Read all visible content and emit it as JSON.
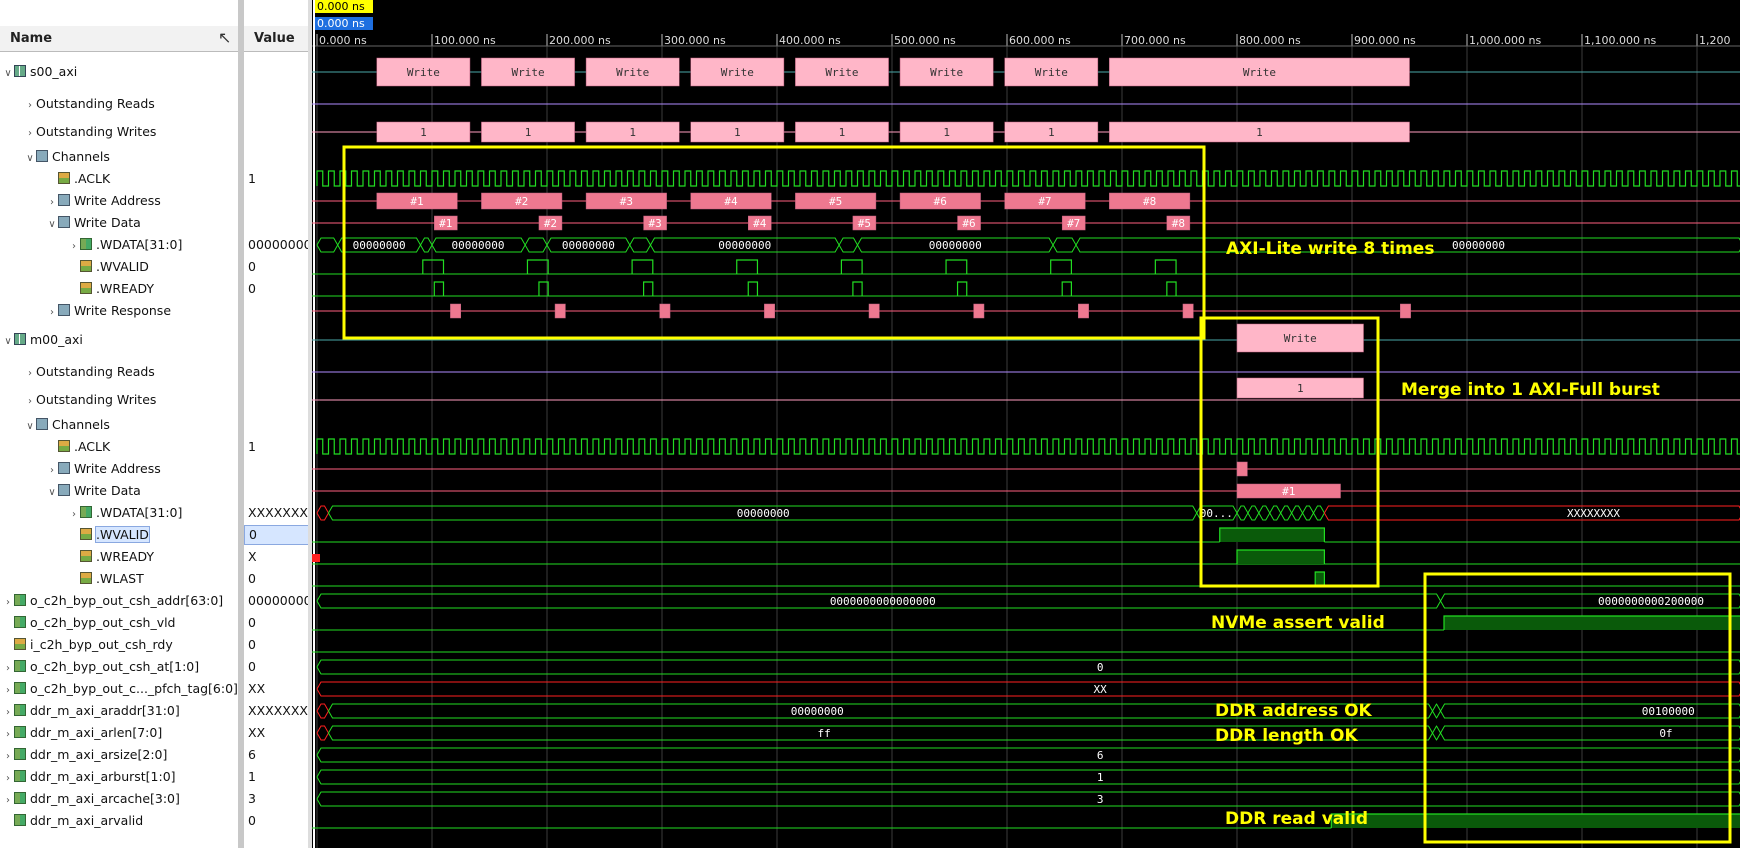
{
  "colors": {
    "wave": "#22dd22",
    "bus_pink": "#ffb6c8",
    "bus_pink_dark": "#ee7890",
    "annot": "#ffff00",
    "grid": "#3b3b3b",
    "cursor_blue": "#1e6fe0",
    "x_red": "#ff2020"
  },
  "header": {
    "name_label": "Name",
    "value_label": "Value",
    "cursor_time": "0.000 ns",
    "cursor_time_blue": "0.000 ns"
  },
  "timeline": {
    "ticks": [
      "0.000 ns",
      "100.000 ns",
      "200.000 ns",
      "300.000 ns",
      "400.000 ns",
      "500.000 ns",
      "600.000 ns",
      "700.000 ns",
      "800.000 ns",
      "900.000 ns",
      "1,000.000 ns",
      "1,100.000 ns",
      "1,200"
    ]
  },
  "signals": [
    {
      "name": "s00_axi",
      "value": "",
      "indent": 0,
      "arrow": "open",
      "icon": "bus"
    },
    {
      "name": "Outstanding Reads",
      "value": "",
      "indent": 1,
      "arrow": "closed",
      "icon": "none"
    },
    {
      "name": "Outstanding Writes",
      "value": "",
      "indent": 1,
      "arrow": "closed",
      "icon": "none"
    },
    {
      "name": "Channels",
      "value": "",
      "indent": 1,
      "arrow": "open",
      "icon": "grp"
    },
    {
      "name": ".ACLK",
      "value": "1",
      "indent": 2,
      "arrow": "none",
      "icon": "sig"
    },
    {
      "name": "Write Address",
      "value": "",
      "indent": 2,
      "arrow": "closed",
      "icon": "grp"
    },
    {
      "name": "Write Data",
      "value": "",
      "indent": 2,
      "arrow": "open",
      "icon": "grp"
    },
    {
      "name": ".WDATA[31:0]",
      "value": "00000000",
      "indent": 3,
      "arrow": "closed",
      "icon": "vec"
    },
    {
      "name": ".WVALID",
      "value": "0",
      "indent": 3,
      "arrow": "none",
      "icon": "sig"
    },
    {
      "name": ".WREADY",
      "value": "0",
      "indent": 3,
      "arrow": "none",
      "icon": "sig"
    },
    {
      "name": "Write Response",
      "value": "",
      "indent": 2,
      "arrow": "closed",
      "icon": "grp"
    },
    {
      "name": "m00_axi",
      "value": "",
      "indent": 0,
      "arrow": "open",
      "icon": "bus"
    },
    {
      "name": "Outstanding Reads",
      "value": "",
      "indent": 1,
      "arrow": "closed",
      "icon": "none"
    },
    {
      "name": "Outstanding Writes",
      "value": "",
      "indent": 1,
      "arrow": "closed",
      "icon": "none"
    },
    {
      "name": "Channels",
      "value": "",
      "indent": 1,
      "arrow": "open",
      "icon": "grp"
    },
    {
      "name": ".ACLK",
      "value": "1",
      "indent": 2,
      "arrow": "none",
      "icon": "sig"
    },
    {
      "name": "Write Address",
      "value": "",
      "indent": 2,
      "arrow": "closed",
      "icon": "grp"
    },
    {
      "name": "Write Data",
      "value": "",
      "indent": 2,
      "arrow": "open",
      "icon": "grp"
    },
    {
      "name": ".WDATA[31:0]",
      "value": "XXXXXXXX",
      "indent": 3,
      "arrow": "closed",
      "icon": "vec"
    },
    {
      "name": ".WVALID",
      "value": "0",
      "indent": 3,
      "arrow": "none",
      "icon": "sig",
      "selected": true
    },
    {
      "name": ".WREADY",
      "value": "X",
      "indent": 3,
      "arrow": "none",
      "icon": "sig"
    },
    {
      "name": ".WLAST",
      "value": "0",
      "indent": 3,
      "arrow": "none",
      "icon": "sig"
    },
    {
      "name": "o_c2h_byp_out_csh_addr[63:0]",
      "value": "00000000",
      "indent": 0,
      "arrow": "closed",
      "icon": "vec"
    },
    {
      "name": "o_c2h_byp_out_csh_vld",
      "value": "0",
      "indent": 0,
      "arrow": "none",
      "icon": "vec"
    },
    {
      "name": "i_c2h_byp_out_csh_rdy",
      "value": "0",
      "indent": 0,
      "arrow": "none",
      "icon": "sig"
    },
    {
      "name": "o_c2h_byp_out_csh_at[1:0]",
      "value": "0",
      "indent": 0,
      "arrow": "closed",
      "icon": "vec"
    },
    {
      "name": "o_c2h_byp_out_c..._pfch_tag[6:0]",
      "value": "XX",
      "indent": 0,
      "arrow": "closed",
      "icon": "vec"
    },
    {
      "name": "ddr_m_axi_araddr[31:0]",
      "value": "XXXXXXXX",
      "indent": 0,
      "arrow": "closed",
      "icon": "vec"
    },
    {
      "name": "ddr_m_axi_arlen[7:0]",
      "value": "XX",
      "indent": 0,
      "arrow": "closed",
      "icon": "vec"
    },
    {
      "name": "ddr_m_axi_arsize[2:0]",
      "value": "6",
      "indent": 0,
      "arrow": "closed",
      "icon": "vec"
    },
    {
      "name": "ddr_m_axi_arburst[1:0]",
      "value": "1",
      "indent": 0,
      "arrow": "closed",
      "icon": "vec"
    },
    {
      "name": "ddr_m_axi_arcache[3:0]",
      "value": "3",
      "indent": 0,
      "arrow": "closed",
      "icon": "vec"
    },
    {
      "name": "ddr_m_axi_arvalid",
      "value": "0",
      "indent": 0,
      "arrow": "none",
      "icon": "vec"
    }
  ],
  "waves": {
    "s_write_label": "Write",
    "s_count_label": "1",
    "s_burst_labels": [
      "#1",
      "#2",
      "#3",
      "#4",
      "#5",
      "#6",
      "#7",
      "#8"
    ],
    "s_wdata_labels": [
      "00000000",
      "00000000",
      "00000000",
      "00000000",
      "00000000",
      "..",
      "..",
      ".."
    ],
    "s_wdata_tail": "00000000",
    "m_write_label": "Write",
    "m_count_label": "1",
    "m_burst_label": "#1",
    "m_wdata_label": "00000000",
    "m_wdata_short": "00...",
    "m_wdata_x": "XXXXXXXX",
    "addr_before": "0000000000000000",
    "addr_after": "0000000000200000",
    "at_value": "0",
    "tag_value": "XX",
    "araddr_before": "00000000",
    "araddr_after": "00100000",
    "arlen_before": "ff",
    "arlen_after": "0f",
    "arsize_value": "6",
    "arburst_value": "1",
    "arcache_value": "3"
  },
  "annotations": {
    "a1": "AXI-Lite write 8 times",
    "a2": "Merge into 1 AXI-Full burst",
    "a3": "NVMe assert valid",
    "a4": "DDR address OK",
    "a5": "DDR length OK",
    "a6": "DDR read valid"
  }
}
